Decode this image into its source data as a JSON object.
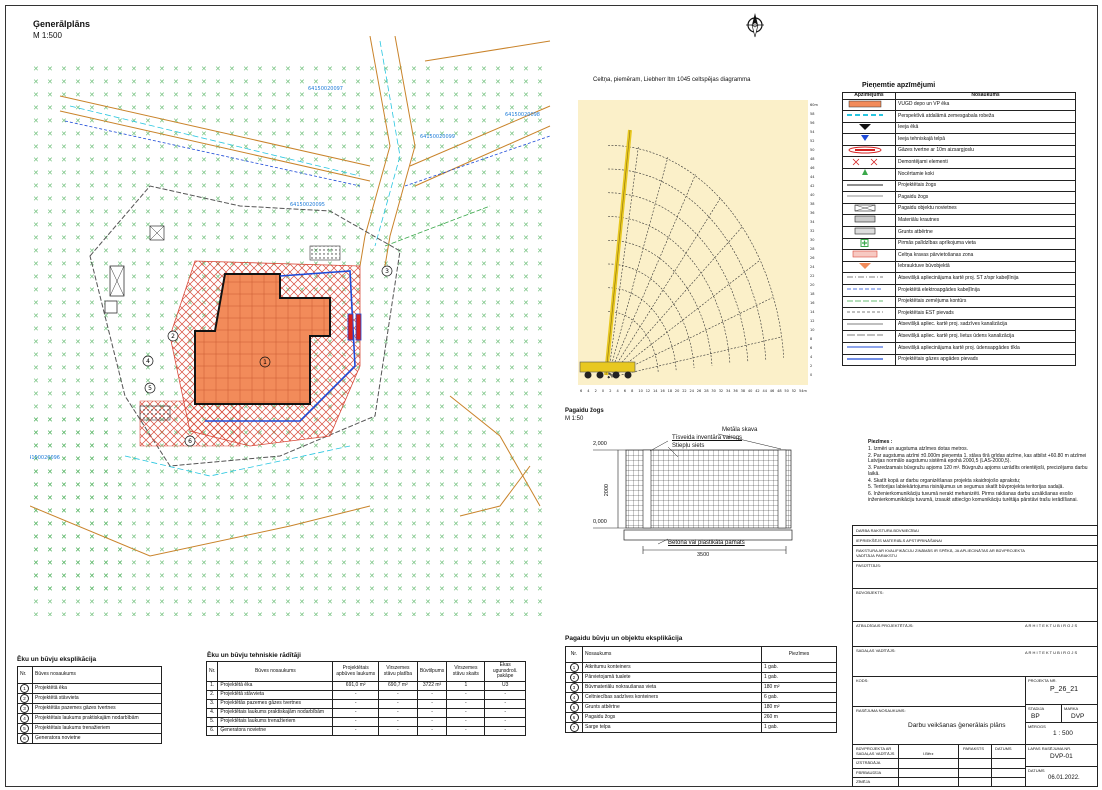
{
  "header": {
    "title": "Ģenerālplāns",
    "scale": "M 1:500"
  },
  "crane": {
    "title": "Celtņa, piemēram, Liebherr ltm 1045 celtspējas diagramma",
    "right_axis": [
      "60m",
      "58",
      "56",
      "54",
      "52",
      "50",
      "48",
      "46",
      "44",
      "42",
      "40",
      "38",
      "36",
      "34",
      "32",
      "30",
      "28",
      "26",
      "24",
      "22",
      "20",
      "18",
      "16",
      "14",
      "12",
      "10",
      "8",
      "6",
      "4",
      "2",
      "0"
    ],
    "bottom_axis": [
      "6",
      "4",
      "2",
      "0",
      "2",
      "4",
      "6",
      "8",
      "10",
      "12",
      "14",
      "16",
      "18",
      "20",
      "22",
      "24",
      "26",
      "28",
      "30",
      "32",
      "34",
      "36",
      "38",
      "40",
      "42",
      "44",
      "46",
      "48",
      "50",
      "52",
      "54m"
    ]
  },
  "legend": {
    "title": "Pieņemtie apzīmējumi",
    "col1": "Apzīmējums",
    "col2": "Nosaukums",
    "items": [
      {
        "name": "VUGD depo un VP ēka",
        "sym": "fill-orange"
      },
      {
        "name": "Perspektīvā atdalāmā zemesgabala robeža",
        "sym": "dash-cyan"
      },
      {
        "name": "Ieeja ēkā",
        "sym": "tri-black"
      },
      {
        "name": "Ieeja tehniskajā telpā",
        "sym": "tri-blue"
      },
      {
        "name": "Gāzes tvertne ar 10m aizsargjoslu",
        "sym": "gas-tank"
      },
      {
        "name": "Demontējami elementi",
        "sym": "red-x"
      },
      {
        "name": "Nocērtamie koki",
        "sym": "green-tree"
      },
      {
        "name": "Projektētais žogs",
        "sym": "line-fence"
      },
      {
        "name": "Pagaidu žogs",
        "sym": "line-thin"
      },
      {
        "name": "Pagaidu objektu novietnes",
        "sym": "box-x"
      },
      {
        "name": "Materiālu krautnes",
        "sym": "box-hatch"
      },
      {
        "name": "Grunts atbērtne",
        "sym": "box-dots"
      },
      {
        "name": "Pirmās palīdzības aprīkojuma vieta",
        "sym": "green-cross"
      },
      {
        "name": "Celtņa kravas pārvietošanas zona",
        "sym": "red-hatch"
      },
      {
        "name": "Iebrauktuve būvobjektā",
        "sym": "orange-arrow"
      },
      {
        "name": "Atsevišķā apliecinājuma kartē proj. ST z/spr kabeļlīnija",
        "sym": "line-dash"
      },
      {
        "name": "Projektētā elektroapgādes kabeļlīnija",
        "sym": "line-bluedash"
      },
      {
        "name": "Projektētais zemējuma kontūrs",
        "sym": "line-green"
      },
      {
        "name": "Projektētais EST pievads",
        "sym": "line-dash2"
      },
      {
        "name": "Atsevišķā apliec. kartē proj. sadzīves kanalizācija",
        "sym": "line-k"
      },
      {
        "name": "Atsevišķā apliec. kartē proj. lietus ūdens kanalizācija",
        "sym": "line-k2"
      },
      {
        "name": "Atsevišķā apliecinājuma kartē proj. ūdensapgādes tīkla",
        "sym": "line-k3"
      },
      {
        "name": "Projektētais gāzes apgādes pievads",
        "sym": "line-gas"
      }
    ]
  },
  "fence": {
    "title": "Pagaidu žogs",
    "scale": "M 1:50",
    "label_metal": "Metāla skava",
    "label_sign": "Tīsveida inventāra vairogs",
    "label_net": "Stiepļu siets",
    "label_base": "Betona vai plastikāta pamats",
    "level_top": "2,000",
    "level_bottom": "0,000",
    "height": "2000",
    "width": "3500"
  },
  "notes": {
    "title": "Piezīmes :",
    "items": [
      "1. Izmēri un augstuma atzīmes dotas metros.",
      "2. Par augstuma atzīmi ±0.000m pieņemta 1. stāva tīrā grīdas atzīme, kas atbilst +60.80 m atzīmei Latvijas normālo augstumu sistēmā epohā 2000,5 (LAS-2000,5).",
      "3. Paredzamais būvgružu apjoms 120 m³. Būvgružu apjoms uzrādīts orientējoši, precizējams darbu laikā.",
      "4. Skatīt kopā ar darbu organizēšanas projekta skaidrojošo aprakstu;",
      "5. Teritorijas labiekārtojuma risinājumus un segumus skatīt būvprojekta teritorijas sadaļā.",
      "6. Inženierkomunikāciju tuvumā nerakt mehanizēti. Pirms rakšanas darbu uzsākšanas esošo inženierkomunikāciju tuvumā, izsaukt attiecīgo komunikāciju turētāja pārstāvi trašu ierādīšanai."
    ]
  },
  "title_block": {
    "r1": "DARBA RAKSTURA BŪVNIECĪBAI",
    "r2": "IEPRIEKŠĒJS MATERIĀLS APSTIPRINĀŠANAI",
    "r3": "RAKSTURA AR KVALIFIKĀCIJU ZINĀMĀS IR SPĒKĀ, JA APLIECINĀTAS AR BŪVPROJEKTA VADĪTĀJA PARAKSTU",
    "l_pasutitajs": "PASŪTĪTĀJS:",
    "l_buvobjekts": "BŪVOBJEKTS:",
    "l_atbildigais": "ATBILDĪGAIS PROJEKTĒTĀJS:",
    "l_sadalas": "SADAĻAS VADĪTĀJS:",
    "l_kods": "KODS:",
    "l_rasejuma": "RASĒJUMA NOSAUKUMS:",
    "firm1": "A R H I T E K T U   B I R O J S",
    "firm2": "A R H I T E K T U   B I R O J S",
    "l_projekta_nr": "PROJEKTA NR.",
    "projekta_nr": "P_26_21",
    "l_stadija": "STADIJA",
    "stadija": "BP",
    "l_marka": "MARKA",
    "marka": "DVP",
    "l_merogs": "MĒROGS",
    "merogs": "1 : 500",
    "drawing_name": "Darbu veikšanas ģenerālais plāns",
    "l_rasejuma_nr": "LAPAS RASĒJUMA NR.",
    "rasejuma_nr": "DVP-01",
    "l_datums": "DATUMS",
    "datums": "06.01.2022.",
    "l_buvprojekta": "BŪVPROJEKTA AR SADAĻAS VADĪTĀJS",
    "l_izstradaja": "IZSTRĀDĀJA",
    "l_parbaudija": "PĀRBAUDĪJA",
    "l_zimeja": "ZĪMĒJA",
    "sig_name": "I.Bērz",
    "l_paraksts": "PARAKSTS",
    "l_datums2": "DATUMS"
  },
  "buildings": {
    "title": "Ēku un būvju eksplikācija",
    "col_nr": "Nr.",
    "col_name": "Būves nosaukums",
    "rows": [
      {
        "nr": "1",
        "name": "Projektētā ēka"
      },
      {
        "nr": "2",
        "name": "Projektētā stāvvieta"
      },
      {
        "nr": "3",
        "name": "Projektētās pazemes gāzes tvertnes"
      },
      {
        "nr": "4",
        "name": "Projektētais laukums praktiskajām nodarbībām"
      },
      {
        "nr": "5",
        "name": "Projektētais laukums trenažieriem"
      },
      {
        "nr": "6",
        "name": "Ģeneratora novietne"
      }
    ]
  },
  "technical": {
    "title": "Ēku un būvju tehniskie rādītāji",
    "headers": [
      "Nr.",
      "Būves nosaukums",
      "Projektētais apbūves laukums",
      "Virszemes stāvu platība",
      "Būvtilpums",
      "Virszemes stāvu skaits",
      "Ēkas ugunsdroš. pakāpe"
    ],
    "rows": [
      [
        "1.",
        "Projektētā ēka",
        "691,0 m²",
        "690,7 m²",
        "3722 m³",
        "1",
        "U3"
      ],
      [
        "2.",
        "Projektētā stāvvieta",
        "-",
        "-",
        "-",
        "-",
        "-"
      ],
      [
        "3.",
        "Projektētās pazemes gāzes tvertnes",
        "-",
        "-",
        "-",
        "-",
        "-"
      ],
      [
        "4.",
        "Projektētais laukums praktiskajām nodarbībām",
        "-",
        "-",
        "-",
        "-",
        "-"
      ],
      [
        "5.",
        "Projektētais laukums trenažieriem",
        "-",
        "-",
        "-",
        "-",
        "-"
      ],
      [
        "6.",
        "Ģeneratora novietne",
        "-",
        "-",
        "-",
        "-",
        "-"
      ]
    ]
  },
  "temporary": {
    "title": "Pagaidu būvju un objektu eksplikācija",
    "headers": [
      "Nr.",
      "Nosaukums",
      "Piezīmes"
    ],
    "rows": [
      [
        "1",
        "Atkritumu konteiners",
        "1 gab."
      ],
      [
        "2",
        "Pārvietojamā tualete",
        "1 gab."
      ],
      [
        "3",
        "Būvmateriālu nokraušanas vieta",
        "180 m²"
      ],
      [
        "4",
        "Celtniecības sadzīves konteiners",
        "6 gab."
      ],
      [
        "5",
        "Grunts atbērtne",
        "180 m²"
      ],
      [
        "6",
        "Pagaidu žogs",
        "260 m"
      ],
      [
        "7",
        "Sarge telpa",
        "1 gab."
      ]
    ]
  },
  "map": {
    "labels": [
      "64150020097",
      "64150020098",
      "64150020099",
      "64150020096",
      "64150020095"
    ],
    "numbers": [
      "1",
      "2",
      "3",
      "4",
      "5",
      "6"
    ]
  },
  "colors": {
    "building": "#f28b5a",
    "hatch": "#d84a3a",
    "road": "#c9832a",
    "crane_bg": "#fbf0c9",
    "crane_arc": "#333333",
    "crane_boom": "#e8c820",
    "util_blue": "#1e4bd8",
    "cyan": "#29c6e0",
    "green": "#3aa84a"
  }
}
